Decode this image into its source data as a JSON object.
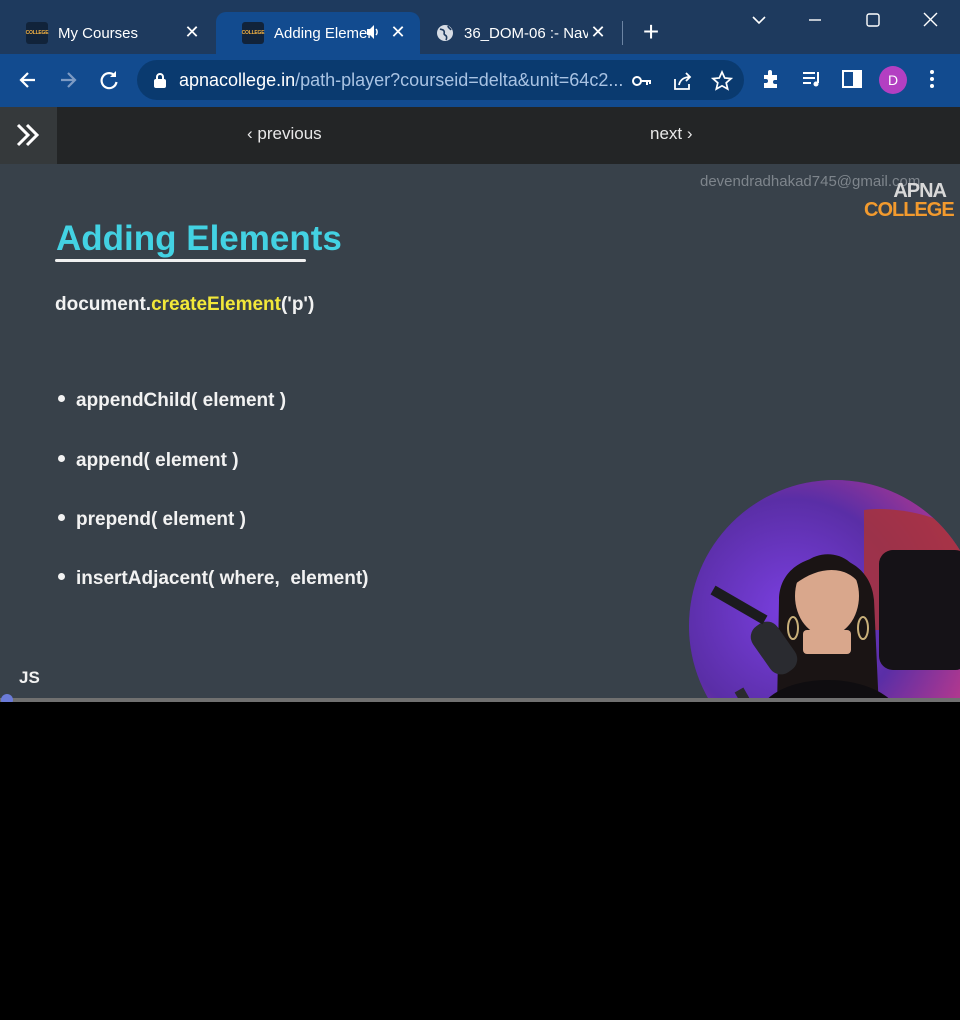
{
  "browser": {
    "tabs": [
      {
        "title": "My Courses",
        "favicon_text": "COLLEGE"
      },
      {
        "title": "Adding Elemen",
        "favicon_text": "COLLEGE",
        "active": true,
        "audio": true
      },
      {
        "title": "36_DOM-06 :- Nav",
        "favicon": "globe-icon"
      }
    ],
    "new_tab_label": "+",
    "window_controls": [
      "chevron-down-icon",
      "minimize-icon",
      "maximize-icon",
      "close-icon"
    ]
  },
  "toolbar": {
    "url_domain": "apnacollege.in",
    "url_rest": "/path-player?courseid=delta&unit=64c2...",
    "avatar_letter": "D",
    "icons": [
      "back-arrow-icon",
      "forward-arrow-icon",
      "reload-icon",
      "lock-icon",
      "key-icon",
      "share-icon",
      "star-icon",
      "puzzle-icon",
      "media-queue-icon",
      "side-panel-icon",
      "more-vert-icon"
    ]
  },
  "coursebar": {
    "previous_label": "previous",
    "next_label": "next",
    "prev_chevron": "‹",
    "next_chevron": "›"
  },
  "slide": {
    "watermark_email": "devendradhakad745@gmail.com",
    "logo_line1": "APNA",
    "logo_line2": "COLLEGE",
    "title": "Adding Elements",
    "code": {
      "object": "document.",
      "method": "createElement",
      "args": "('p')"
    },
    "bullets": [
      "appendChild( element )",
      "append( element )",
      "prepend( element )",
      "insertAdjacent( where,  element)"
    ],
    "footer_label": "JS"
  },
  "player": {
    "progress_fraction": 0.0,
    "accent_color": "#6b7bd8"
  }
}
